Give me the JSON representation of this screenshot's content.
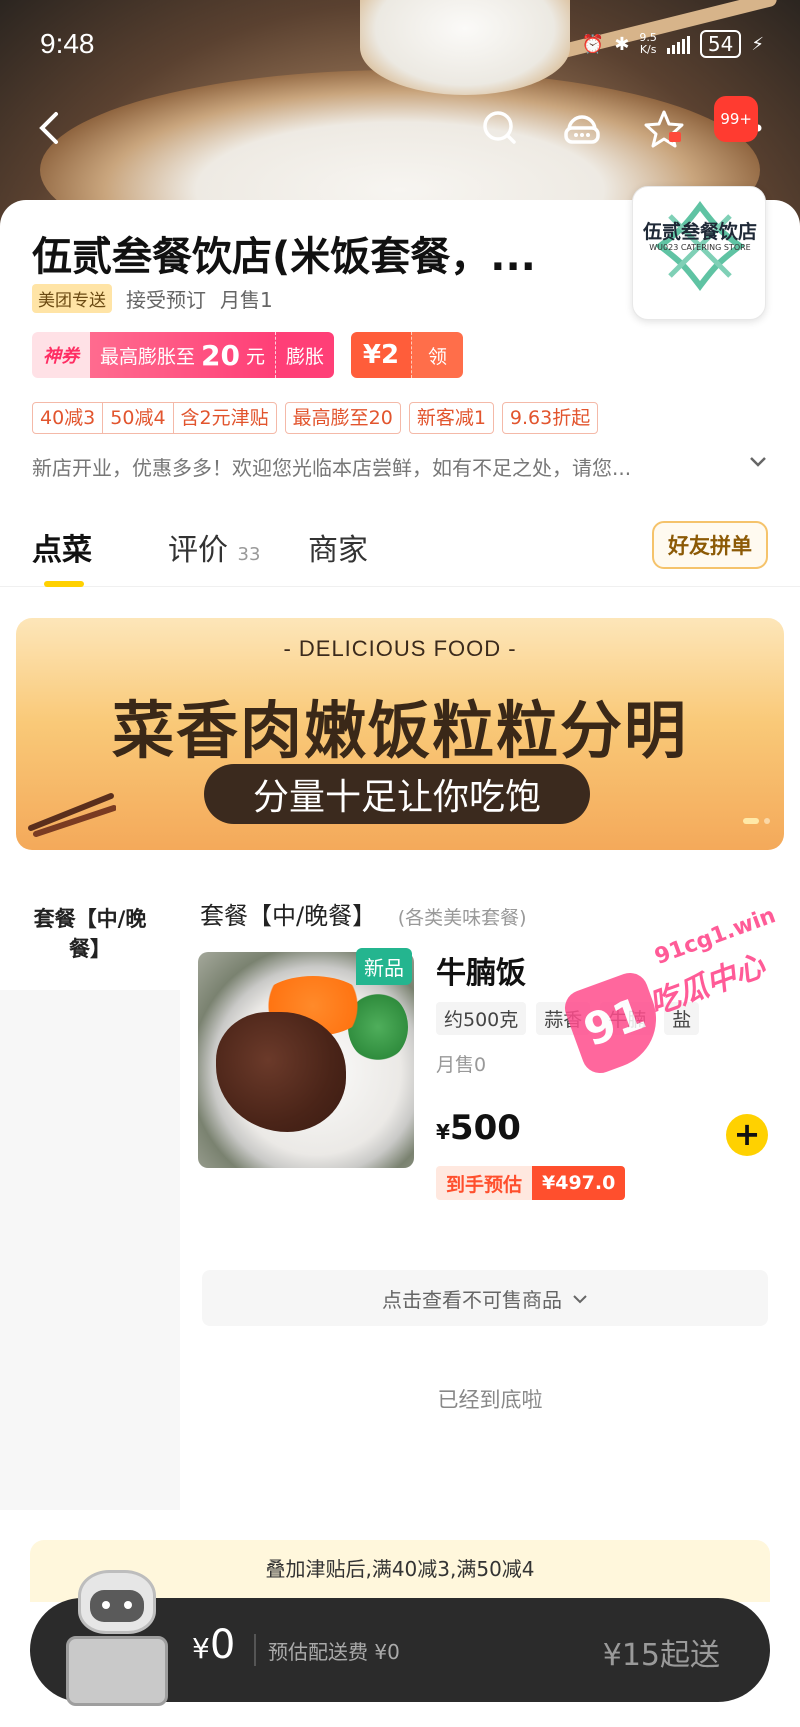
{
  "status_bar": {
    "time": "9:48",
    "speed_top": "9.5",
    "speed_bottom": "K/s",
    "battery": "54"
  },
  "nav": {
    "badge": "99+"
  },
  "store": {
    "name": "伍贰叁餐饮店(米饭套餐，...",
    "delivery_tag": "美团专送",
    "reserve_text": "接受预订",
    "monthly_sales": "月售1",
    "logo_text": "伍贰叁餐饮店",
    "logo_subtext": "WU023 CATERING STORE"
  },
  "coupons": {
    "god_label": "神券",
    "expand_text_prefix": "最高膨胀至",
    "expand_amount": "20",
    "expand_unit": "元",
    "expand_button": "膨胀",
    "cash_amount": "¥2",
    "cash_button": "领"
  },
  "promos": {
    "group": [
      "40减3",
      "50减4",
      "含2元津贴"
    ],
    "items": [
      "最高膨至20",
      "新客减1",
      "9.63折起"
    ]
  },
  "notice": "新店开业，优惠多多！欢迎您光临本店尝鲜，如有不足之处，请您...",
  "tabs": {
    "order": "点菜",
    "reviews": "评价",
    "reviews_count": "33",
    "merchant": "商家",
    "friend_button": "好友拼单"
  },
  "banner": {
    "subtitle": "- DELICIOUS FOOD -",
    "title": "菜香肉嫩饭粒粒分明",
    "pill": "分量十足让你吃饱"
  },
  "menu": {
    "left_category": "套餐【中/晚餐】",
    "category_title": "套餐【中/晚餐】",
    "category_note": "(各类美味套餐)",
    "dish": {
      "badge": "新品",
      "name": "牛腩饭",
      "tags": [
        "约500克",
        "蒜香",
        "牛腩",
        "盐"
      ],
      "sold": "月售0",
      "currency": "¥",
      "price": "500",
      "est_label": "到手预估",
      "est_value": "¥497.0"
    },
    "unsold_toggle": "点击查看不可售商品",
    "end_text": "已经到底啦"
  },
  "watermark": {
    "logo": "91",
    "site": "91cg1.win",
    "name": "吃瓜中心"
  },
  "cart": {
    "subsidy_text": "叠加津贴后,满40减3,满50减4",
    "currency": "¥",
    "amount": "0",
    "delivery_fee": "预估配送费 ¥0",
    "min_order": "¥15起送"
  },
  "icons": {
    "back": "back-arrow-icon",
    "search": "search-icon",
    "service": "customer-service-icon",
    "favorite": "star-icon",
    "more": "more-icon",
    "add": "plus-icon",
    "expand": "chevron-down-icon"
  },
  "colors": {
    "brand_yellow": "#ffd100",
    "coupon_pink": "#ff3f77",
    "promo_red": "#e2552e",
    "new_badge_green": "#24b58f",
    "cart_bar": "#2b2b2b"
  }
}
